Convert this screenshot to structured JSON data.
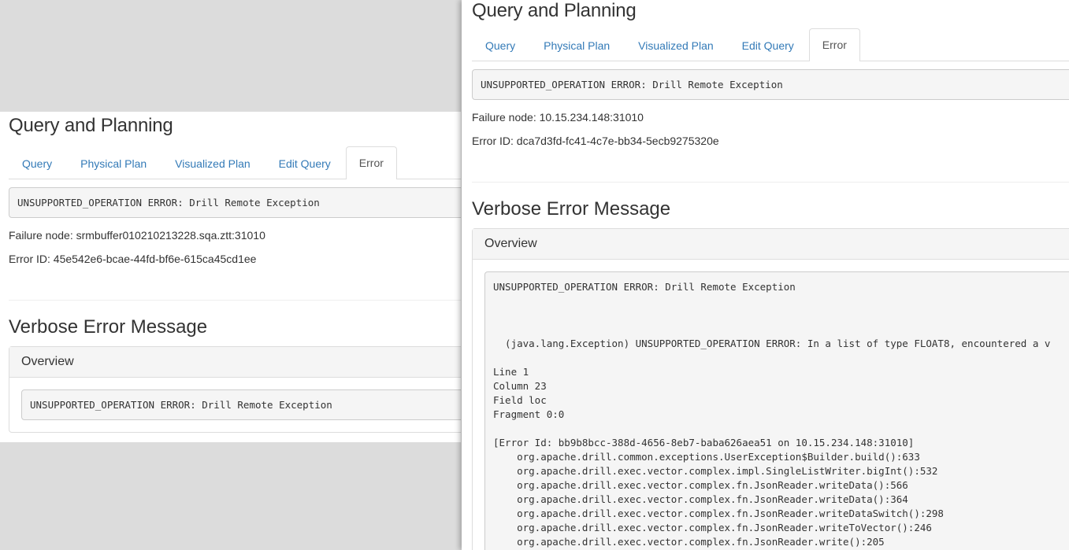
{
  "left": {
    "title": "Query and Planning",
    "tabs": [
      "Query",
      "Physical Plan",
      "Visualized Plan",
      "Edit Query",
      "Error"
    ],
    "error_summary": "UNSUPPORTED_OPERATION ERROR: Drill Remote Exception",
    "failure_node": "Failure node: srmbuffer010210213228.sqa.ztt:31010",
    "error_id": "Error ID: 45e542e6-bcae-44fd-bf6e-615ca45cd1ee",
    "verbose_title": "Verbose Error Message",
    "overview_label": "Overview",
    "overview_text": "UNSUPPORTED_OPERATION ERROR: Drill Remote Exception"
  },
  "right": {
    "title": "Query and Planning",
    "tabs": [
      "Query",
      "Physical Plan",
      "Visualized Plan",
      "Edit Query",
      "Error"
    ],
    "error_summary": "UNSUPPORTED_OPERATION ERROR: Drill Remote Exception",
    "failure_node": "Failure node: 10.15.234.148:31010",
    "error_id": "Error ID: dca7d3fd-fc41-4c7e-bb34-5ecb9275320e",
    "verbose_title": "Verbose Error Message",
    "overview_label": "Overview",
    "overview_text": "UNSUPPORTED_OPERATION ERROR: Drill Remote Exception\n\n\n\n  (java.lang.Exception) UNSUPPORTED_OPERATION ERROR: In a list of type FLOAT8, encountered a v\n\nLine 1\nColumn 23\nField loc\nFragment 0:0\n\n[Error Id: bb9b8bcc-388d-4656-8eb7-baba626aea51 on 10.15.234.148:31010]\n    org.apache.drill.common.exceptions.UserException$Builder.build():633\n    org.apache.drill.exec.vector.complex.impl.SingleListWriter.bigInt():532\n    org.apache.drill.exec.vector.complex.fn.JsonReader.writeData():566\n    org.apache.drill.exec.vector.complex.fn.JsonReader.writeData():364\n    org.apache.drill.exec.vector.complex.fn.JsonReader.writeDataSwitch():298\n    org.apache.drill.exec.vector.complex.fn.JsonReader.writeToVector():246\n    org.apache.drill.exec.vector.complex.fn.JsonReader.write():205"
  }
}
